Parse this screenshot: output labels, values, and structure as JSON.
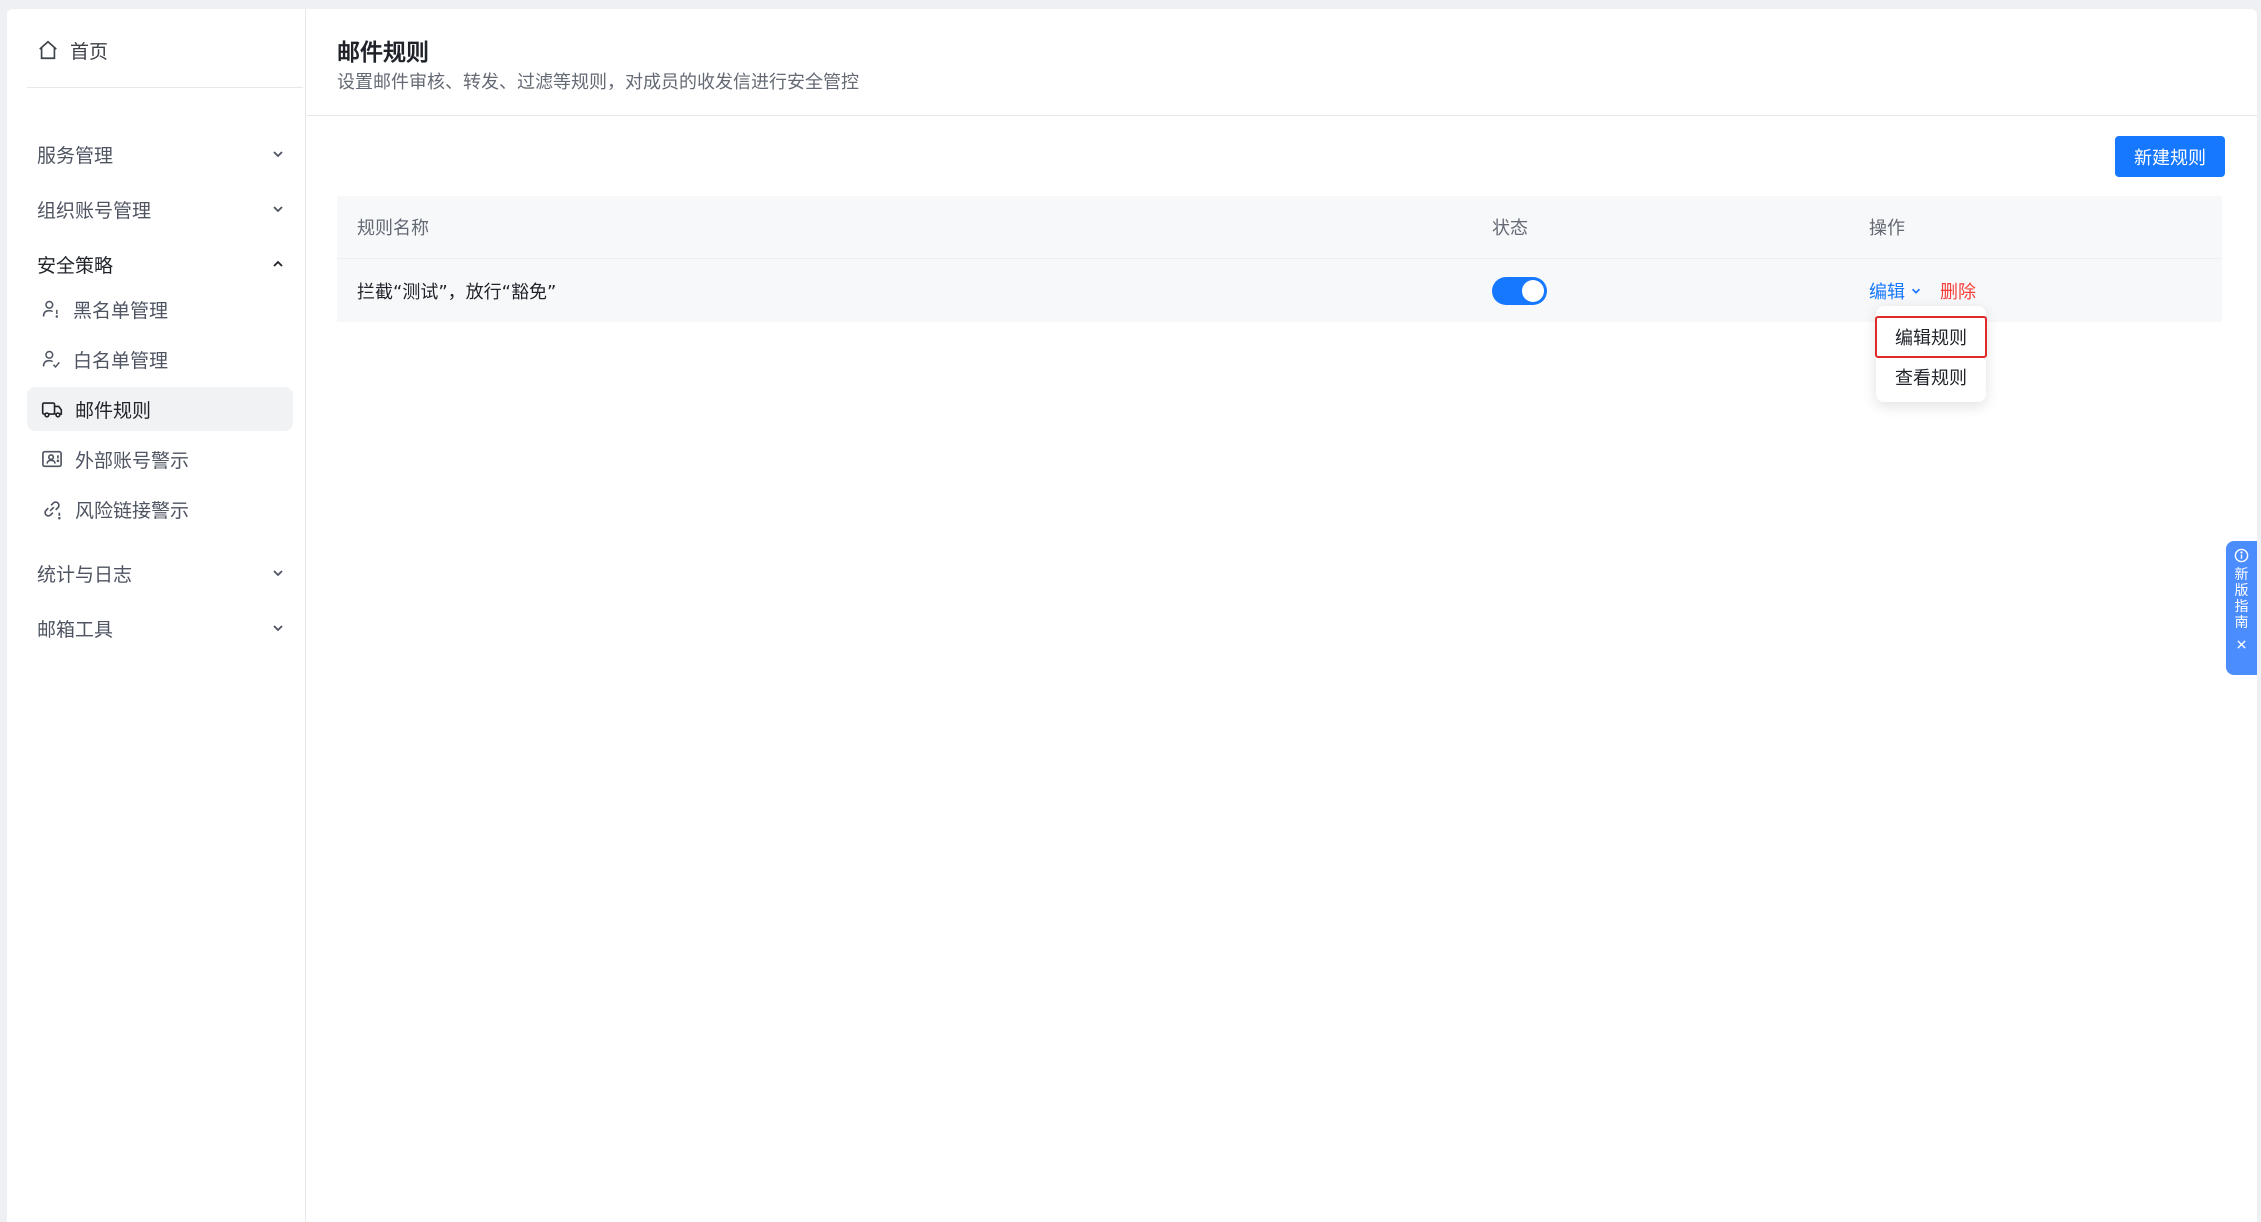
{
  "sidebar": {
    "home": "首页",
    "groups": [
      {
        "label": "服务管理",
        "expanded": false
      },
      {
        "label": "组织账号管理",
        "expanded": false
      },
      {
        "label": "安全策略",
        "expanded": true
      },
      {
        "label": "统计与日志",
        "expanded": false
      },
      {
        "label": "邮箱工具",
        "expanded": false
      }
    ],
    "security_items": [
      {
        "label": "黑名单管理",
        "icon": "user-block-icon"
      },
      {
        "label": "白名单管理",
        "icon": "user-check-icon"
      },
      {
        "label": "邮件规则",
        "icon": "mail-rule-icon",
        "active": true
      },
      {
        "label": "外部账号警示",
        "icon": "external-account-icon"
      },
      {
        "label": "风险链接警示",
        "icon": "risk-link-icon"
      }
    ]
  },
  "header": {
    "title": "邮件规则",
    "description": "设置邮件审核、转发、过滤等规则，对成员的收发信进行安全管控"
  },
  "toolbar": {
    "new_rule": "新建规则"
  },
  "table": {
    "columns": [
      "规则名称",
      "状态",
      "操作"
    ],
    "rows": [
      {
        "name": "拦截“测试”，放行“豁免”",
        "status_on": true,
        "edit": "编辑",
        "delete": "删除"
      }
    ]
  },
  "dropdown": {
    "items": [
      "编辑规则",
      "查看规则"
    ]
  },
  "guide": {
    "text": "新版指南"
  },
  "colors": {
    "primary": "#1677ff",
    "danger": "#f5403a",
    "highlight": "#e02a2a"
  }
}
